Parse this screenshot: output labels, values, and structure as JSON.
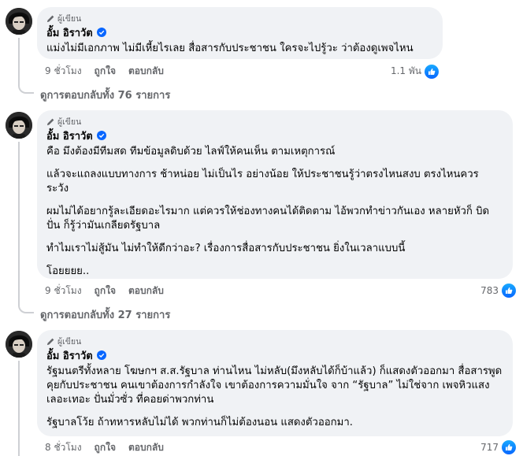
{
  "comments": [
    {
      "badge": "ผู้เขียน",
      "author": "อั้ม อิราวัต",
      "paragraphs": [
        "แม่งไม่มีเอกภาพ ไม่มีเหี้ยไรเลย สื่อสารกับประชาชน ใครจะไปรู้วะ ว่าต้องดูเพจไหน"
      ],
      "time": "9 ชั่วโมง",
      "like_label": "ถูกใจ",
      "reply_label": "ตอบกลับ",
      "reaction_count": "1.1 พัน",
      "view_replies": "ดูการตอบกลับทั้ง 76 รายการ"
    },
    {
      "badge": "ผู้เขียน",
      "author": "อั้ม อิราวัต",
      "paragraphs": [
        "คือ มึงต้องมีทีมสด ทีมข้อมูลดิบด้วย ไลฟ์ให้คนเห็น ตามเหตุการณ์",
        "แล้วจะแถลงแบบทางการ ช้าหน่อย ไม่เป็นไร อย่างน้อย ให้ประชาชนรู้ว่าตรงไหนสงบ ตรงไหนควร ระวัง",
        "ผมไม่ได้อยากรู้ละเอียดอะไรมาก แต่ควรให้ช่องทางคนได้ติดตาม ไอ้พวกทำข่าวกันเอง หลายหัวก็ บิด ปั่น ก็รู้ว่ามันเกลียดรัฐบาล",
        "ทำไมเราไม่สู้มัน ไม่ทำให้ดีกว่าอะ? เรื่องการสื่อสารกับประชาชน ยิ่งในเวลาแบบนี้",
        "โอยยยย.."
      ],
      "time": "9 ชั่วโมง",
      "like_label": "ถูกใจ",
      "reply_label": "ตอบกลับ",
      "reaction_count": "783",
      "view_replies": "ดูการตอบกลับทั้ง 27 รายการ"
    },
    {
      "badge": "ผู้เขียน",
      "author": "อั้ม อิราวัต",
      "paragraphs": [
        "รัฐมนตรีทั้งหลาย โฆษกฯ ส.ส.รัฐบาล ท่านไหน ไม่หลับ(มึงหลับได้ก็บ้าแล้ว) ก็แสดงตัวออกมา สื่อสารพูดคุยกับประชาชน คนเขาต้องการกำลังใจ เขาต้องการความมั่นใจ จาก “รัฐบาล” ไม่ใช่จาก เพจหิวแสง เลอะเทอะ ปั่นมั่วซั่ว ที่คอยด่าพวกท่าน",
        "รัฐบาลโว้ย ถ้าทหารหลับไม่ได้ พวกท่านก็ไม่ต้องนอน แสดงตัวออกมา."
      ],
      "time": "8 ชั่วโมง",
      "like_label": "ถูกใจ",
      "reply_label": "ตอบกลับ",
      "reaction_count": "717"
    }
  ],
  "colors": {
    "bubble": "#f0f2f5",
    "secondary_text": "#65676b",
    "accent": "#0866ff",
    "thread_line": "#ced0d4"
  },
  "icons": {
    "badge": "pencil-icon",
    "verified": "verified-badge-icon",
    "reaction": "like-icon"
  }
}
